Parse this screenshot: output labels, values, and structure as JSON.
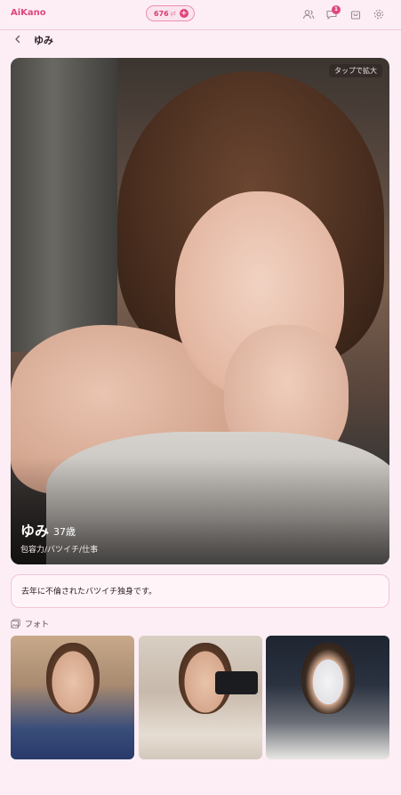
{
  "header": {
    "logo": "AiKano",
    "points_value": "676",
    "points_unit": "pt",
    "points_plus_icon": "plus-icon",
    "notifications_badge": "1",
    "icons": [
      "friends-icon",
      "chat-icon",
      "shop-bag-icon",
      "settings-gear-icon"
    ]
  },
  "nav": {
    "back_icon": "chevron-left-icon",
    "title": "ゆみ"
  },
  "profile": {
    "zoom_hint": "タップで拡大",
    "name": "ゆみ",
    "age": "37歳",
    "tags": "包容力/バツイチ/仕事",
    "bio": "去年に不倫されたバツイチ独身です。"
  },
  "photos": {
    "icon": "photo-gallery-icon",
    "heading": "フォト",
    "count": 3
  },
  "colors": {
    "accent": "#e0457b",
    "background": "#fdeef5",
    "border": "#f2c5d7"
  }
}
